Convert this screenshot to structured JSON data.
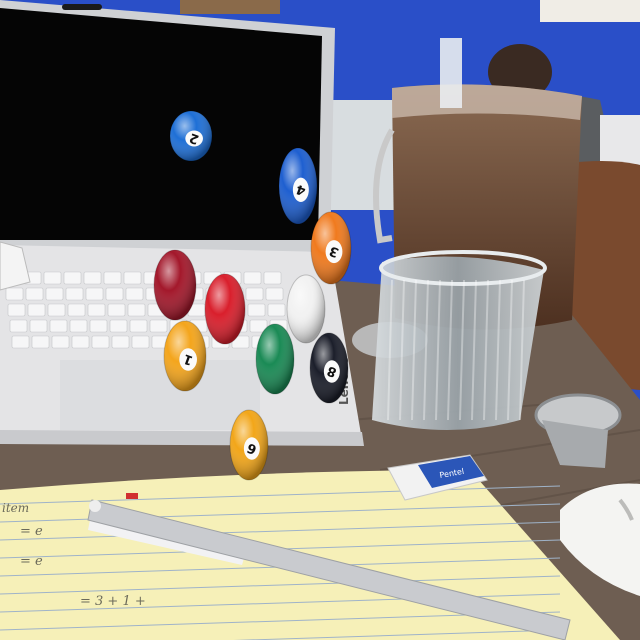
{
  "laptop": {
    "brand": "Lenovo"
  },
  "screen_balls": [
    {
      "number": "2",
      "color": "#1e6fd6"
    },
    {
      "number": "4",
      "color": "#1e5fd0"
    }
  ],
  "floating_balls": [
    {
      "number": "3",
      "color": "#f07a1e"
    },
    {
      "number": "",
      "color": "#a3182b"
    },
    {
      "number": "",
      "color": "#d91f2c"
    },
    {
      "number": "",
      "color": "#f2f2f2"
    },
    {
      "number": "1",
      "color": "#f4a51c"
    },
    {
      "number": "",
      "color": "#1a8a55"
    },
    {
      "number": "8",
      "color": "#1b1e2a"
    },
    {
      "number": "6",
      "color": "#f2a619"
    }
  ],
  "eraser": {
    "brand": "Pentel"
  },
  "notepad": {
    "lines": [
      "item",
      "= e",
      "= e",
      "= 3 + 1 +"
    ]
  },
  "colors": {
    "wall": "#2a4fc8",
    "table": "#6e5e52",
    "notepad": "#f6f0b8",
    "laptop": "#e4e4e6"
  }
}
